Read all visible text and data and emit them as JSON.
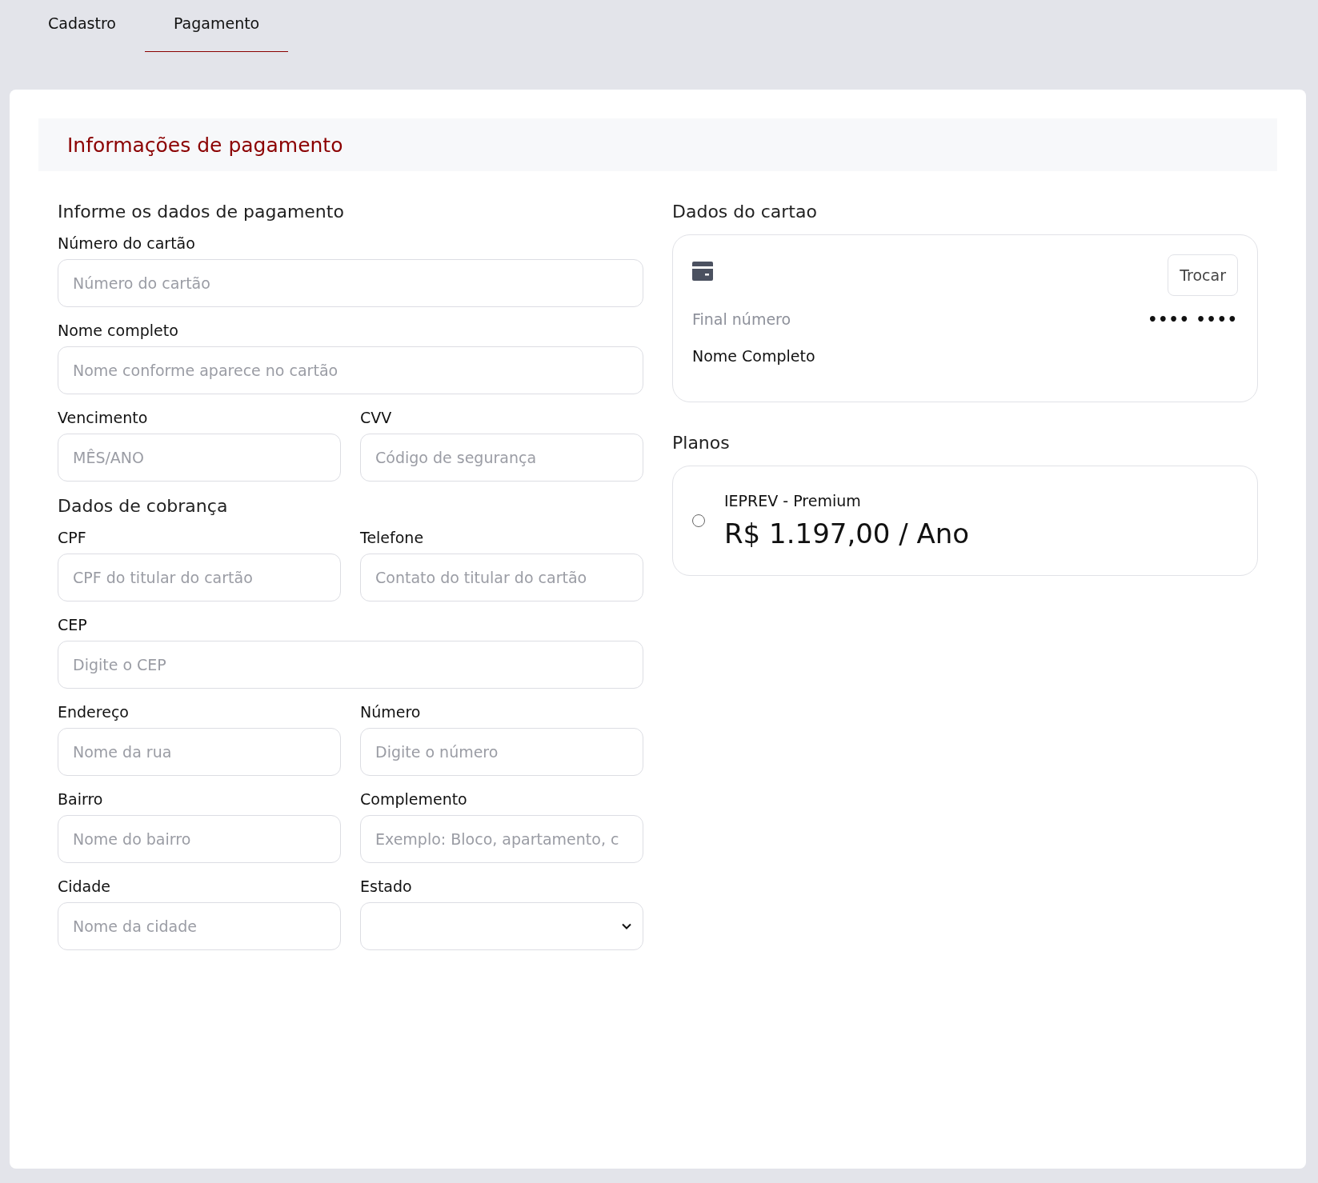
{
  "tabs": [
    {
      "label": "Cadastro",
      "selected": false
    },
    {
      "label": "Pagamento",
      "selected": true
    }
  ],
  "header": {
    "title": "Informações de pagamento"
  },
  "form_sections": [
    {
      "title": "Informe os dados de pagamento",
      "rows": [
        [
          {
            "label": "Número do cartão",
            "placeholder": "Número do cartão",
            "kind": "input"
          }
        ],
        [
          {
            "label": "Nome completo",
            "placeholder": "Nome conforme aparece no cartão",
            "kind": "input"
          }
        ],
        [
          {
            "label": "Vencimento",
            "placeholder": "MÊS/ANO",
            "kind": "input"
          },
          {
            "label": "CVV",
            "placeholder": "Código de segurança",
            "kind": "input"
          }
        ]
      ]
    },
    {
      "title": "Dados de cobrança",
      "rows": [
        [
          {
            "label": "CPF",
            "placeholder": "CPF do titular do cartão",
            "kind": "input"
          },
          {
            "label": "Telefone",
            "placeholder": "Contato do titular do cartão",
            "kind": "input"
          }
        ],
        [
          {
            "label": "CEP",
            "placeholder": "Digite o CEP",
            "kind": "input"
          }
        ],
        [
          {
            "label": "Endereço",
            "placeholder": "Nome da rua",
            "kind": "input"
          },
          {
            "label": "Número",
            "placeholder": "Digite o número",
            "kind": "input"
          }
        ],
        [
          {
            "label": "Bairro",
            "placeholder": "Nome do bairro",
            "kind": "input"
          },
          {
            "label": "Complemento",
            "placeholder": "Exemplo: Bloco, apartamento, c",
            "kind": "input"
          }
        ],
        [
          {
            "label": "Cidade",
            "placeholder": "Nome da cidade",
            "kind": "input"
          },
          {
            "label": "Estado",
            "kind": "select"
          }
        ]
      ]
    }
  ],
  "card_section": {
    "title": "Dados do cartao",
    "change_button": "Trocar",
    "final_label": "Final número",
    "masked_number": "•••• ••••",
    "holder_name": "Nome Completo"
  },
  "plans_section": {
    "title": "Planos",
    "plans": [
      {
        "name": "IEPREV - Premium",
        "price": "R$ 1.197,00 / Ano",
        "selected": false
      }
    ]
  }
}
